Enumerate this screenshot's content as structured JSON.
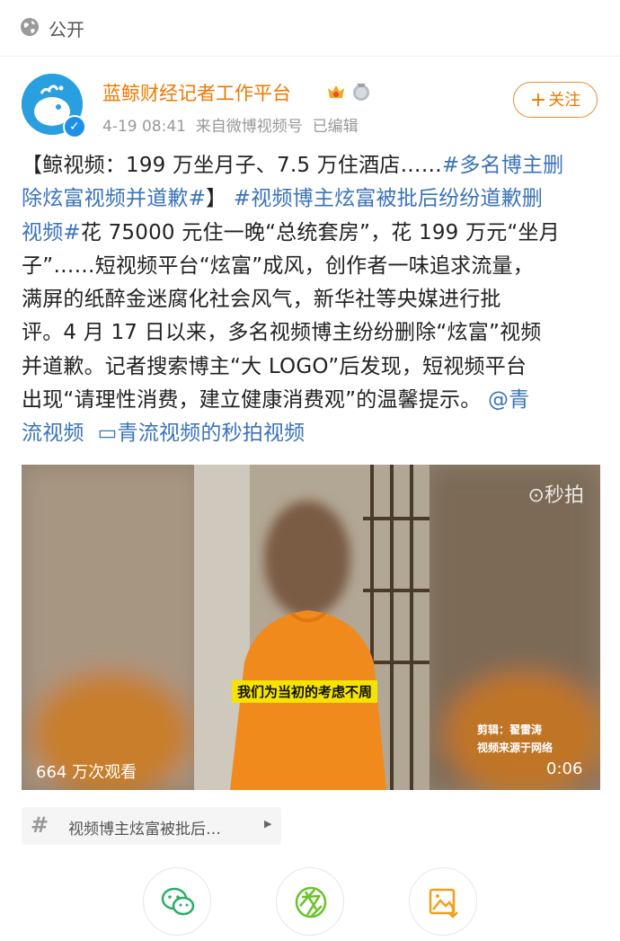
{
  "header": {
    "visibility_label": "公开",
    "visibility_icon": "globe-icon"
  },
  "author": {
    "name": "蓝鲸财经记者工作平台",
    "time": "4-19 08:41",
    "source_prefix": "来自",
    "source": "微博视频号",
    "edited": "已编辑",
    "follow_label": "关注",
    "badges": [
      "crown-badge-icon",
      "medal-badge-icon"
    ],
    "verified_icon": "verified-icon"
  },
  "post": {
    "line_1": "【鲸视频：199 万坐月子、7.5 万住酒店……",
    "hashtag_1a": "#多名博主删",
    "hashtag_1b": "除炫富视频并道歉#",
    "text_2": "】",
    "hashtag_2a": "#视频博主炫富被批后纷纷道歉删",
    "hashtag_2b": "视频#",
    "body_1": "花 75000 元住一晚“总统套房”，花 199 万元“坐月",
    "body_2": "子”……短视频平台“炫富”成风，创作者一味追求流量，",
    "body_3": "满屏的纸醉金迷腐化社会风气，新华社等央媒进行批",
    "body_4": "评。4 月 17 日以来，多名视频博主纷纷删除“炫富”视频",
    "body_5": "并道歉。记者搜索博主“大 LOGO”后发现，短视频平台",
    "body_6": "出现“请理性消费，建立健康消费观”的温馨提示。",
    "mention_a": "@青",
    "mention_b": "流视频",
    "video_link": "青流视频的秒拍视频"
  },
  "video": {
    "watermark": "秒拍",
    "subtitle": "我们为当初的考虑不周",
    "credit_1": "剪辑：翟雷涛",
    "credit_2": "视频来源于网络",
    "views": "664 万次观看",
    "duration": "0:06"
  },
  "topic": {
    "label": "视频博主炫富被批后…"
  },
  "share_buttons": [
    "wechat-icon",
    "moments-icon",
    "save-image-icon"
  ],
  "colors": {
    "accent": "#f07800",
    "link": "#3a73b9"
  }
}
